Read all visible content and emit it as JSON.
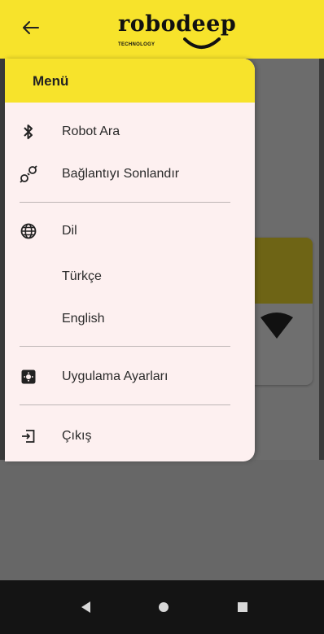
{
  "appbar": {
    "logo_text": "robodeep",
    "logo_subtitle": "TECHNOLOGY",
    "back_icon": "arrow-left-icon"
  },
  "drawer": {
    "title": "Menü",
    "items": [
      {
        "label": "Robot Ara",
        "icon": "bluetooth-icon"
      },
      {
        "label": "Bağlantıyı Sonlandır",
        "icon": "plug-disconnect-icon"
      },
      {
        "label": "Dil",
        "icon": "globe-icon"
      },
      {
        "label": "Türkçe",
        "icon": ""
      },
      {
        "label": "English",
        "icon": ""
      },
      {
        "label": "Uygulama Ayarları",
        "icon": "settings-box-icon"
      },
      {
        "label": "Çıkış",
        "icon": "logout-icon"
      }
    ]
  },
  "background": {
    "card_icon": "wifi-icon"
  },
  "navbar": {
    "back": "nav-back-icon",
    "home": "nav-home-icon",
    "recents": "nav-recents-icon"
  },
  "colors": {
    "accent": "#f7e32b",
    "drawer_bg": "#fdf0f0",
    "scrim": "#6c6c6c",
    "navbar": "#141414"
  }
}
